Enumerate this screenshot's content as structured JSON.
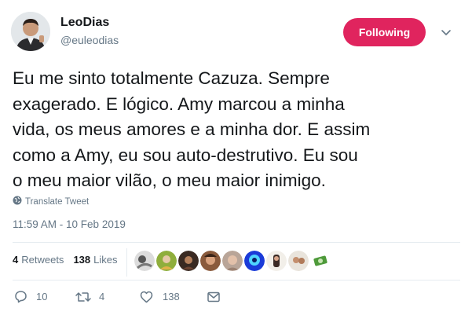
{
  "author": {
    "name": "LeoDias",
    "handle": "@euleodias"
  },
  "follow_button_label": "Following",
  "tweet": {
    "text_lines": [
      "Eu me sinto totalmente Cazuza. Sempre",
      "exagerado. E lógico. Amy marcou a minha",
      "vida, os meus amores e a minha dor. E assim",
      "como a Amy, eu sou auto-destrutivo. Eu sou",
      "o meu maior vilão, o meu maior inimigo."
    ],
    "translate_label": "Translate Tweet",
    "timestamp": "11:59 AM - 10 Feb 2019"
  },
  "stats": {
    "retweets_count": "4",
    "retweets_label": "Retweets",
    "likes_count": "138",
    "likes_label": "Likes"
  },
  "liker_avatar_count": 9,
  "actions": {
    "reply_count": "10",
    "retweet_count": "4",
    "like_count": "138"
  },
  "colors": {
    "follow_button": "#e0245e",
    "secondary_text": "#657786",
    "primary_text": "#14171a"
  },
  "icons": {
    "chevron": "chevron-down-icon",
    "translate": "globe-icon",
    "reply": "reply-icon",
    "retweet": "retweet-icon",
    "like": "heart-icon",
    "message": "envelope-icon"
  }
}
